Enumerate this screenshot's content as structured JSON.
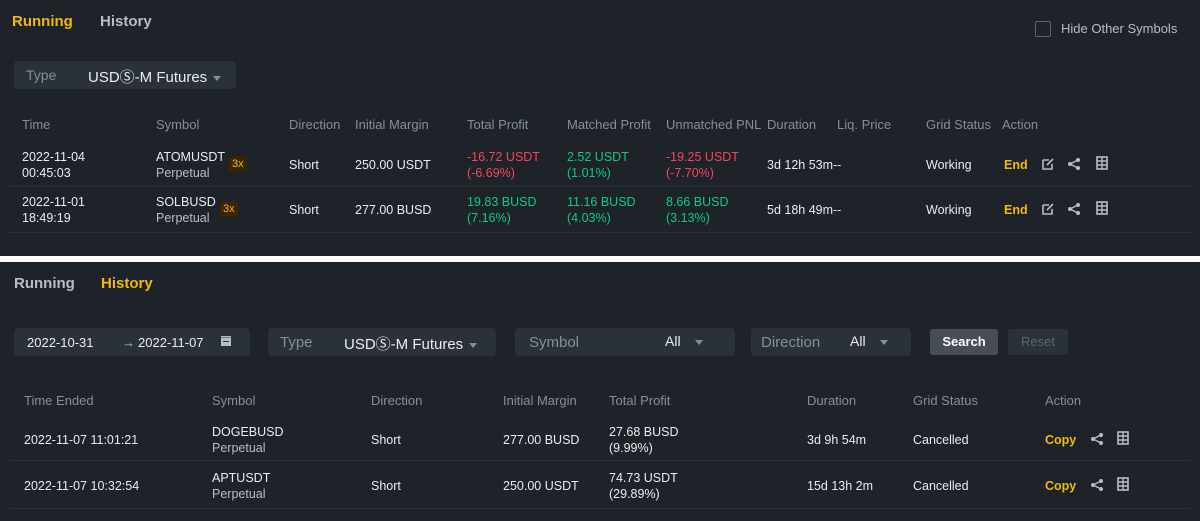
{
  "running": {
    "tabs": [
      "Running",
      "History"
    ],
    "hide_other_symbols": "Hide Other Symbols",
    "type_label": "Type",
    "type_value": "USDⓈ-M Futures",
    "columns": [
      "Time",
      "Symbol",
      "Direction",
      "Initial Margin",
      "Total Profit",
      "Matched Profit",
      "Unmatched PNL",
      "Duration",
      "Liq. Price",
      "Grid Status",
      "Action"
    ],
    "rows": [
      {
        "date": "2022-11-04",
        "time": "00:45:03",
        "symbol": "ATOMUSDT",
        "contract": "Perpetual",
        "leverage": "3x",
        "direction": "Short",
        "initial_margin": "250.00 USDT",
        "total_profit": "-16.72 USDT",
        "total_profit_pct": "(-6.69%)",
        "matched_profit": "2.52 USDT",
        "matched_profit_pct": "(1.01%)",
        "unmatched_pnl": "-19.25 USDT",
        "unmatched_pnl_pct": "(-7.70%)",
        "duration": "3d 12h 53m--",
        "grid_status": "Working",
        "action": "End"
      },
      {
        "date": "2022-11-01",
        "time": "18:49:19",
        "symbol": "SOLBUSD",
        "contract": "Perpetual",
        "leverage": "3x",
        "direction": "Short",
        "initial_margin": "277.00 BUSD",
        "total_profit": "19.83 BUSD",
        "total_profit_pct": "(7.16%)",
        "matched_profit": "11.16 BUSD",
        "matched_profit_pct": "(4.03%)",
        "unmatched_pnl": "8.66 BUSD",
        "unmatched_pnl_pct": "(3.13%)",
        "duration": "5d 18h 49m--",
        "grid_status": "Working",
        "action": "End"
      }
    ]
  },
  "history": {
    "tabs": [
      "Running",
      "History"
    ],
    "date_from": "2022-10-31",
    "arrow": "→",
    "date_to": "2022-11-07",
    "type_label": "Type",
    "type_value": "USDⓈ-M Futures",
    "symbol_label": "Symbol",
    "symbol_value": "All",
    "direction_label": "Direction",
    "direction_value": "All",
    "search": "Search",
    "reset": "Reset",
    "columns": [
      "Time Ended",
      "Symbol",
      "Direction",
      "Initial Margin",
      "Total Profit",
      "Duration",
      "Grid Status",
      "Action"
    ],
    "rows": [
      {
        "time_ended": "2022-11-07 11:01:21",
        "symbol": "DOGEBUSD",
        "contract": "Perpetual",
        "direction": "Short",
        "initial_margin": "277.00 BUSD",
        "total_profit": "27.68 BUSD",
        "total_profit_pct": "(9.99%)",
        "duration": "3d 9h 54m",
        "grid_status": "Cancelled",
        "action": "Copy"
      },
      {
        "time_ended": "2022-11-07 10:32:54",
        "symbol": "APTUSDT",
        "contract": "Perpetual",
        "direction": "Short",
        "initial_margin": "250.00 USDT",
        "total_profit": "74.73 USDT",
        "total_profit_pct": "(29.89%)",
        "duration": "15d 13h 2m",
        "grid_status": "Cancelled",
        "action": "Copy"
      }
    ]
  },
  "colors": {
    "accent": "#f0b90b",
    "profit": "#0ecb81",
    "loss": "#f6465d",
    "panel": "#1e2329"
  },
  "icons": [
    "edit-icon",
    "share-icon",
    "details-icon",
    "calendar-icon"
  ]
}
